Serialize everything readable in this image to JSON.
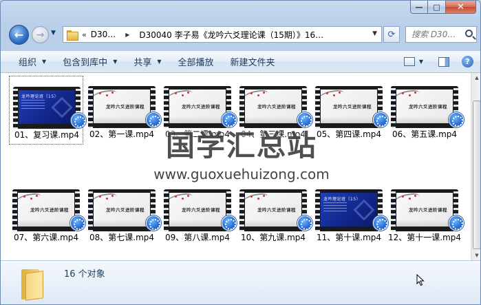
{
  "window": {
    "caption": {
      "minimize": "—",
      "maximize": "□",
      "close": "✕"
    }
  },
  "address": {
    "overflow": "«",
    "crumbs": [
      "D30…",
      "D30040 李子易《龙吟六爻理论课（15期）》16…"
    ],
    "refresh": "⟳",
    "search_placeholder": "搜索 D30…"
  },
  "toolbar": {
    "organize": "组织",
    "include_library": "包含到库中",
    "share": "共享",
    "play_all": "全部播放",
    "new_folder": "新建文件夹",
    "help": "?"
  },
  "files": [
    {
      "label": "01、复习课.mp4",
      "style": "blue",
      "frame_text": "龙吟理论班（15）"
    },
    {
      "label": "02、第一课.mp4",
      "style": "ink",
      "frame_text": "龙吟六爻进阶课程"
    },
    {
      "label": "03、第二课.mp4",
      "style": "ink",
      "frame_text": "龙吟六爻进阶课程"
    },
    {
      "label": "04、第三课.mp4",
      "style": "ink",
      "frame_text": "龙吟六爻进阶课程"
    },
    {
      "label": "05、第四课.mp4",
      "style": "ink",
      "frame_text": "龙吟六爻进阶课程"
    },
    {
      "label": "06、第五课.mp4",
      "style": "ink",
      "frame_text": "龙吟六爻进阶课程"
    },
    {
      "label": "07、第六课.mp4",
      "style": "ink",
      "frame_text": "龙吟六爻进阶课程"
    },
    {
      "label": "08、第七课.mp4",
      "style": "ink",
      "frame_text": "龙吟六爻进阶课程"
    },
    {
      "label": "09、第八课.mp4",
      "style": "ink",
      "frame_text": "龙吟六爻进阶课程"
    },
    {
      "label": "10、第九课.mp4",
      "style": "ink",
      "frame_text": "龙吟六爻进阶课程"
    },
    {
      "label": "11、第十课.mp4",
      "style": "blue",
      "frame_text": "龙吟理论班（15）"
    },
    {
      "label": "12、第十一课.mp4",
      "style": "ink",
      "frame_text": "龙吟六爻进阶课程"
    }
  ],
  "watermark": {
    "title": "国学汇总站",
    "url": "www.guoxuehuizong.com"
  },
  "status": {
    "count": "16 个对象"
  }
}
